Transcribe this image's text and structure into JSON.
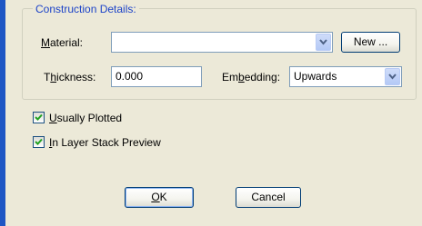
{
  "group": {
    "title": "Construction Details:",
    "material_label": {
      "pre": "",
      "key": "M",
      "post": "aterial:"
    },
    "material_value": "",
    "new_button": "New ...",
    "thickness_label": {
      "pre": "T",
      "key": "h",
      "post": "ickness:"
    },
    "thickness_value": "0.000",
    "embedding_label": {
      "pre": "Em",
      "key": "b",
      "post": "edding:"
    },
    "embedding_value": "Upwards"
  },
  "options": {
    "usually_plotted": {
      "key": "U",
      "rest": "sually Plotted",
      "checked": true
    },
    "layer_stack_preview": {
      "pre": "",
      "key": "I",
      "rest": "n Layer Stack Preview",
      "checked": true
    }
  },
  "buttons": {
    "ok": {
      "key": "O",
      "rest": "K"
    },
    "cancel": "Cancel"
  },
  "colors": {
    "accent": "#1e56c4",
    "group_title": "#1c43c8",
    "dialog_bg": "#ece9d8"
  }
}
